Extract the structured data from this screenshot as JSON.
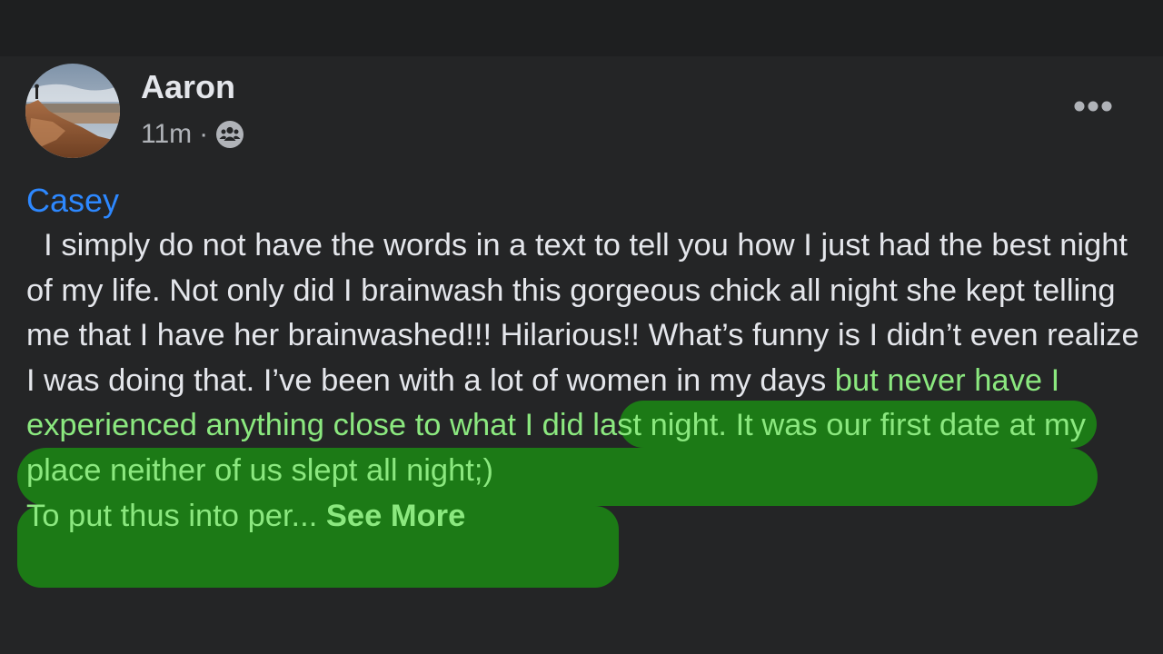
{
  "post": {
    "author": "Aaron",
    "time": "11m",
    "separator": "·",
    "audience_icon": "group-icon",
    "mention": "Casey",
    "text_plain": "  I simply do not have the words in a text to tell you how I just had the best night of my life. Not only did I brainwash this gorgeous chick all night she kept telling me that I have her brainwashed!!! Hilarious!! What’s funny is I didn’t even realize I was doing that. I’ve been with a lot of women in my days ",
    "text_highlighted": "but never have I experienced anything close to what I did last night. It was our first date at my place neither of us slept all night;)\nTo put thus into per... ",
    "see_more_label": "See More",
    "options_icon": "more-horizontal-icon"
  },
  "colors": {
    "background": "#242526",
    "text": "#e4e6eb",
    "secondary_text": "#b0b3b8",
    "mention": "#2d88ff",
    "highlight_background": "#1c7a16",
    "highlight_text": "#8be87f"
  }
}
